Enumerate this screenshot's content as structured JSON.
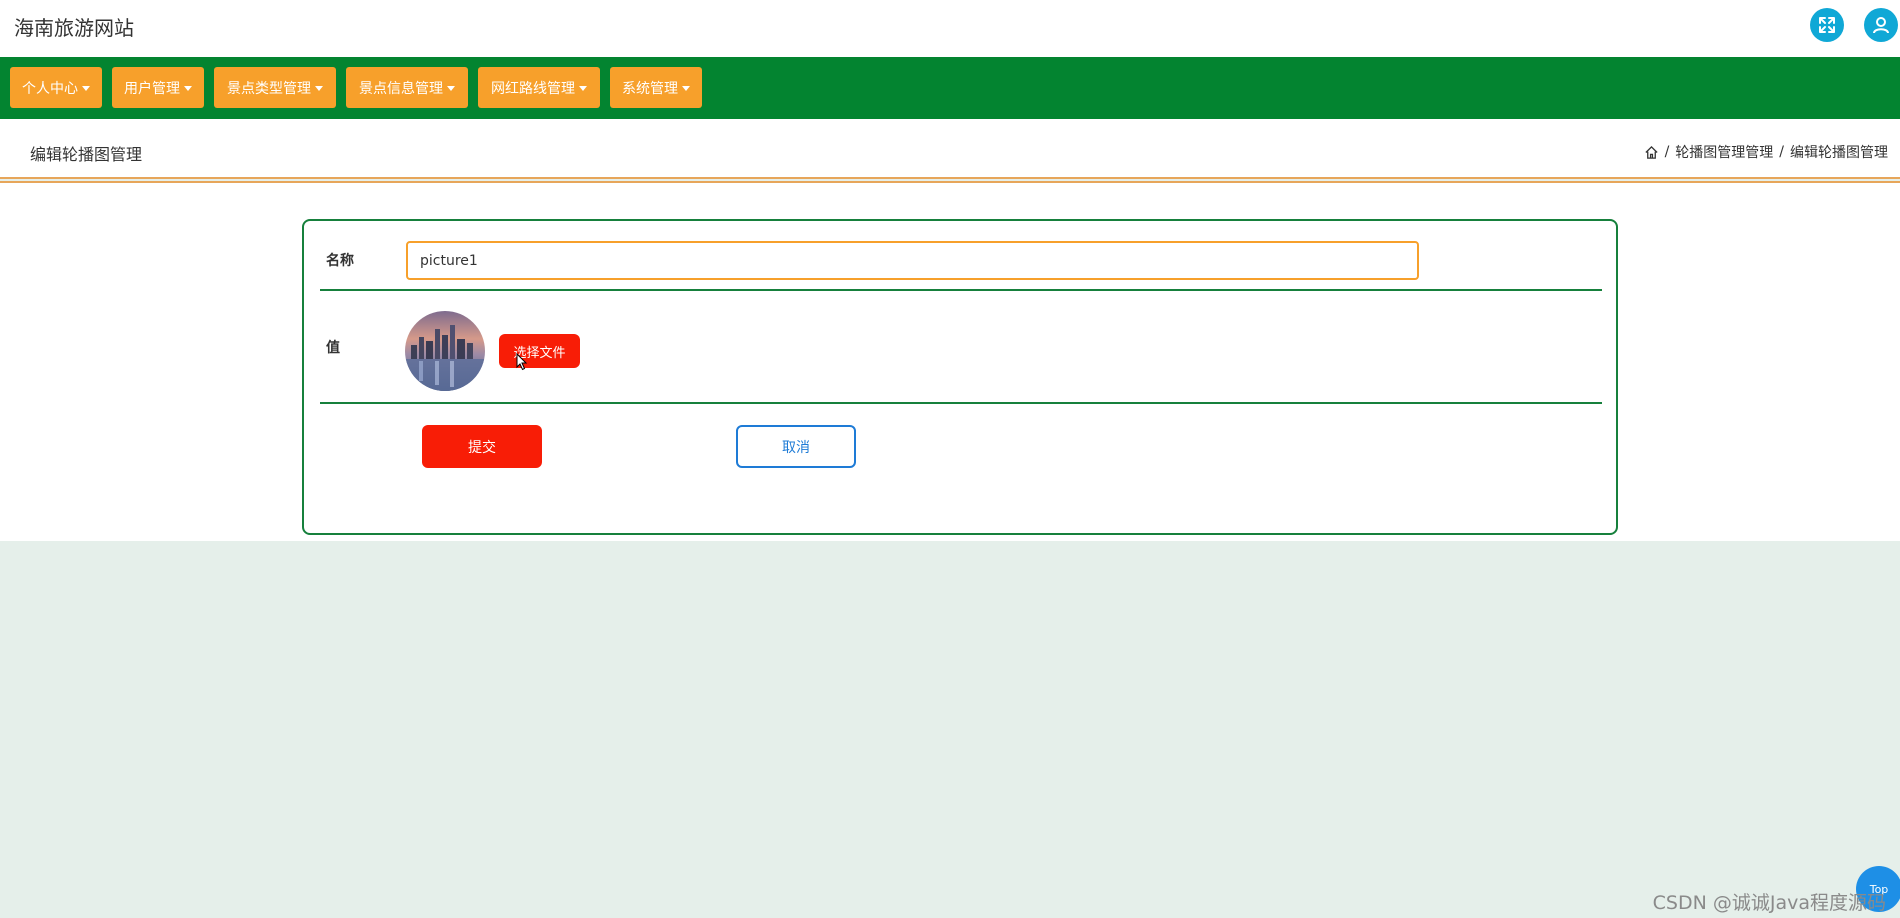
{
  "header": {
    "site_title": "海南旅游网站",
    "fullscreen_icon": "expand-icon",
    "user_icon": "user-icon"
  },
  "nav": {
    "items": [
      {
        "label": "个人中心"
      },
      {
        "label": "用户管理"
      },
      {
        "label": "景点类型管理"
      },
      {
        "label": "景点信息管理"
      },
      {
        "label": "网红路线管理"
      },
      {
        "label": "系统管理"
      }
    ]
  },
  "page": {
    "heading": "编辑轮播图管理",
    "breadcrumb": {
      "home_icon": "home-icon",
      "separator": "/",
      "items": [
        "轮播图管理管理",
        "编辑轮播图管理"
      ]
    }
  },
  "form": {
    "name_label": "名称",
    "name_value": "picture1",
    "value_label": "值",
    "file_button": "选择文件",
    "submit_label": "提交",
    "cancel_label": "取消"
  },
  "footer": {
    "top_label": "Top",
    "watermark": "CSDN @诚诚Java程度源码"
  },
  "colors": {
    "nav_bg": "#038430",
    "nav_item": "#f7a02b",
    "accent_red": "#f81d06",
    "accent_blue": "#1e7bd6",
    "card_border": "#16803c"
  }
}
